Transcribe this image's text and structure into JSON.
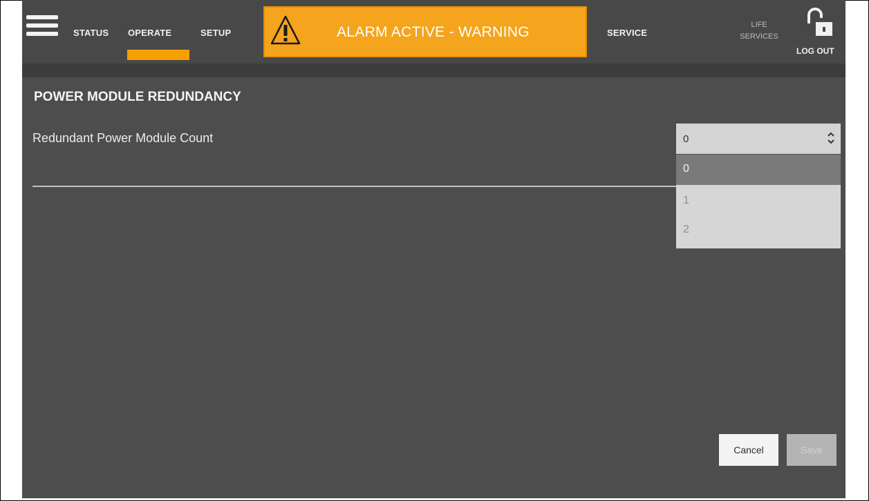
{
  "nav": {
    "status": "STATUS",
    "operate": "OPERATE",
    "setup": "SETUP",
    "service": "SERVICE",
    "life_services_line1": "LIFE",
    "life_services_line2": "SERVICES",
    "logout": "LOG OUT",
    "active_tab": "OPERATE"
  },
  "alarm": {
    "text": "ALARM ACTIVE - WARNING",
    "icon": "warning-triangle-icon",
    "color": "#f5a41e"
  },
  "panel": {
    "title": "POWER MODULE REDUNDANCY",
    "field_label": "Redundant Power Module Count",
    "select_value": "0",
    "options": [
      "0",
      "1",
      "2"
    ],
    "selected_option": "0"
  },
  "buttons": {
    "cancel": "Cancel",
    "save": "Save"
  },
  "colors": {
    "accent": "#f5a000",
    "background": "#3c3c3c",
    "panel": "#4d4d4d",
    "topbar": "#484848"
  }
}
